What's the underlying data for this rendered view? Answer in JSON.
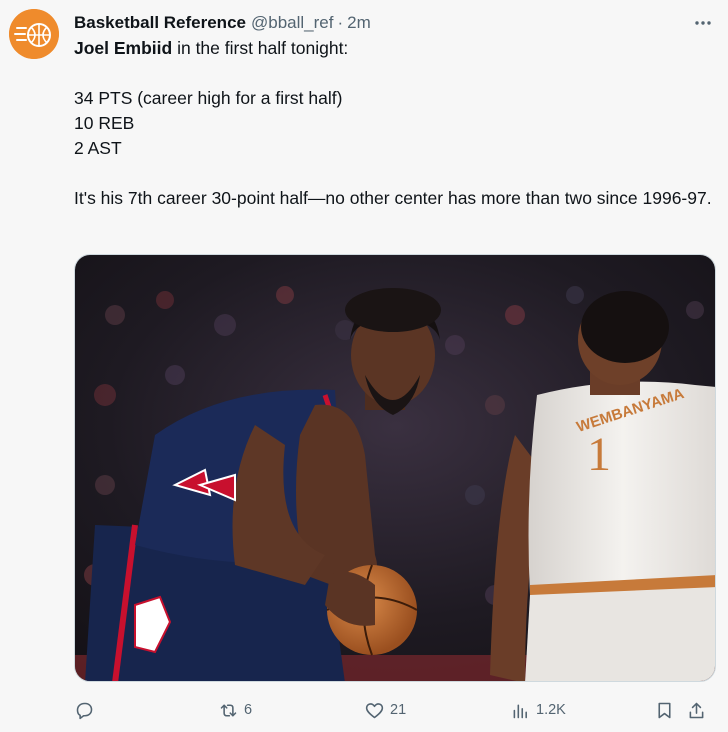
{
  "post": {
    "author_name": "Basketball Reference",
    "author_handle": "@bball_ref",
    "separator": "·",
    "timestamp": "2m",
    "text": {
      "subject": "Joel Embiid",
      "intro_rest": " in the first half tonight:",
      "stat_lines": [
        "34 PTS (career high for a first half)",
        "10 REB",
        "2 AST"
      ],
      "closing": "It's his 7th career 30-point half—no other center has more than two since 1996-97."
    },
    "media": {
      "jersey_name": "WEMBANYAMA",
      "jersey_number": "1"
    }
  },
  "actions": {
    "replies": "",
    "reposts": "6",
    "likes": "21",
    "views": "1.2K"
  },
  "icons": {
    "avatar": "basketball-logo-icon",
    "more": "more-horizontal-icon",
    "reply": "reply-icon",
    "repost": "repost-icon",
    "like": "heart-icon",
    "views": "analytics-icon",
    "bookmark": "bookmark-icon",
    "share": "share-icon"
  },
  "colors": {
    "brand_orange": "#ef8b2c",
    "text": "#0f1419",
    "muted": "#536471",
    "background": "#f7f7f7"
  }
}
